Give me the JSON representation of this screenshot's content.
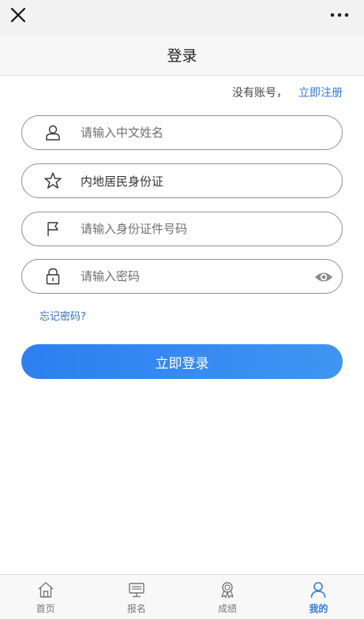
{
  "header": {
    "title": "登录"
  },
  "register": {
    "prompt": "没有账号，",
    "link_label": "立即注册"
  },
  "form": {
    "name": {
      "placeholder": "请输入中文姓名",
      "icon": "user-icon"
    },
    "id_type": {
      "value": "内地居民身份证",
      "icon": "star-icon"
    },
    "id_number": {
      "placeholder": "请输入身份证件号码",
      "icon": "flag-icon"
    },
    "password": {
      "placeholder": "请输入密码",
      "icon": "lock-icon"
    }
  },
  "forgot_label": "忘记密码?",
  "login_label": "立即登录",
  "colors": {
    "accent": "#2f7ae5",
    "button_start": "#2d7ff0",
    "button_end": "#3f95f2"
  },
  "tabs": [
    {
      "label": "首页",
      "icon": "home-icon"
    },
    {
      "label": "报名",
      "icon": "monitor-icon"
    },
    {
      "label": "成绩",
      "icon": "award-icon"
    },
    {
      "label": "我的",
      "icon": "person-icon",
      "active": true
    }
  ]
}
